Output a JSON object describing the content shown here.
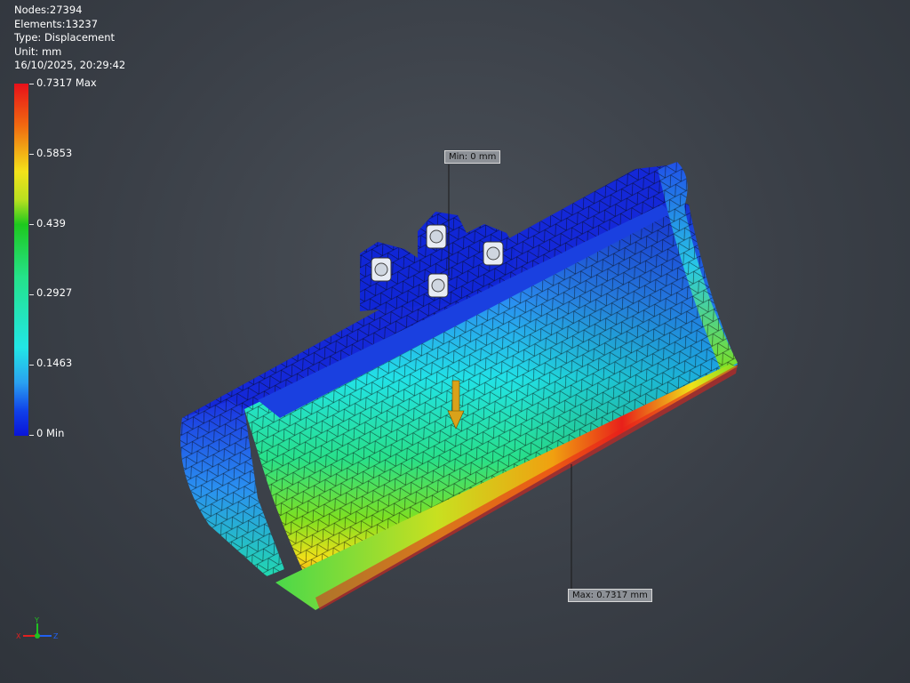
{
  "info": {
    "nodes": "Nodes:27394",
    "elements": "Elements:13237",
    "type": "Type: Displacement",
    "unit": "Unit: mm",
    "timestamp": "16/10/2025, 20:29:42"
  },
  "legend": {
    "labels": [
      "0.7317 Max",
      "0.5853",
      "0.439",
      "0.2927",
      "0.1463",
      "0 Min"
    ],
    "colors": [
      "#e8101a",
      "#f3e21a",
      "#1ec81e",
      "#25e28a",
      "#22e6e6",
      "#0a14d8"
    ]
  },
  "probes": {
    "min_label": "Min: 0 mm",
    "max_label": "Max: 0.7317 mm"
  },
  "triad": {
    "x": "X",
    "y": "Y",
    "z": "Z"
  },
  "colors": {
    "background": "#3a3f47",
    "mesh_line": "#0a0a0a",
    "load_arrow": "#d9a21a"
  }
}
